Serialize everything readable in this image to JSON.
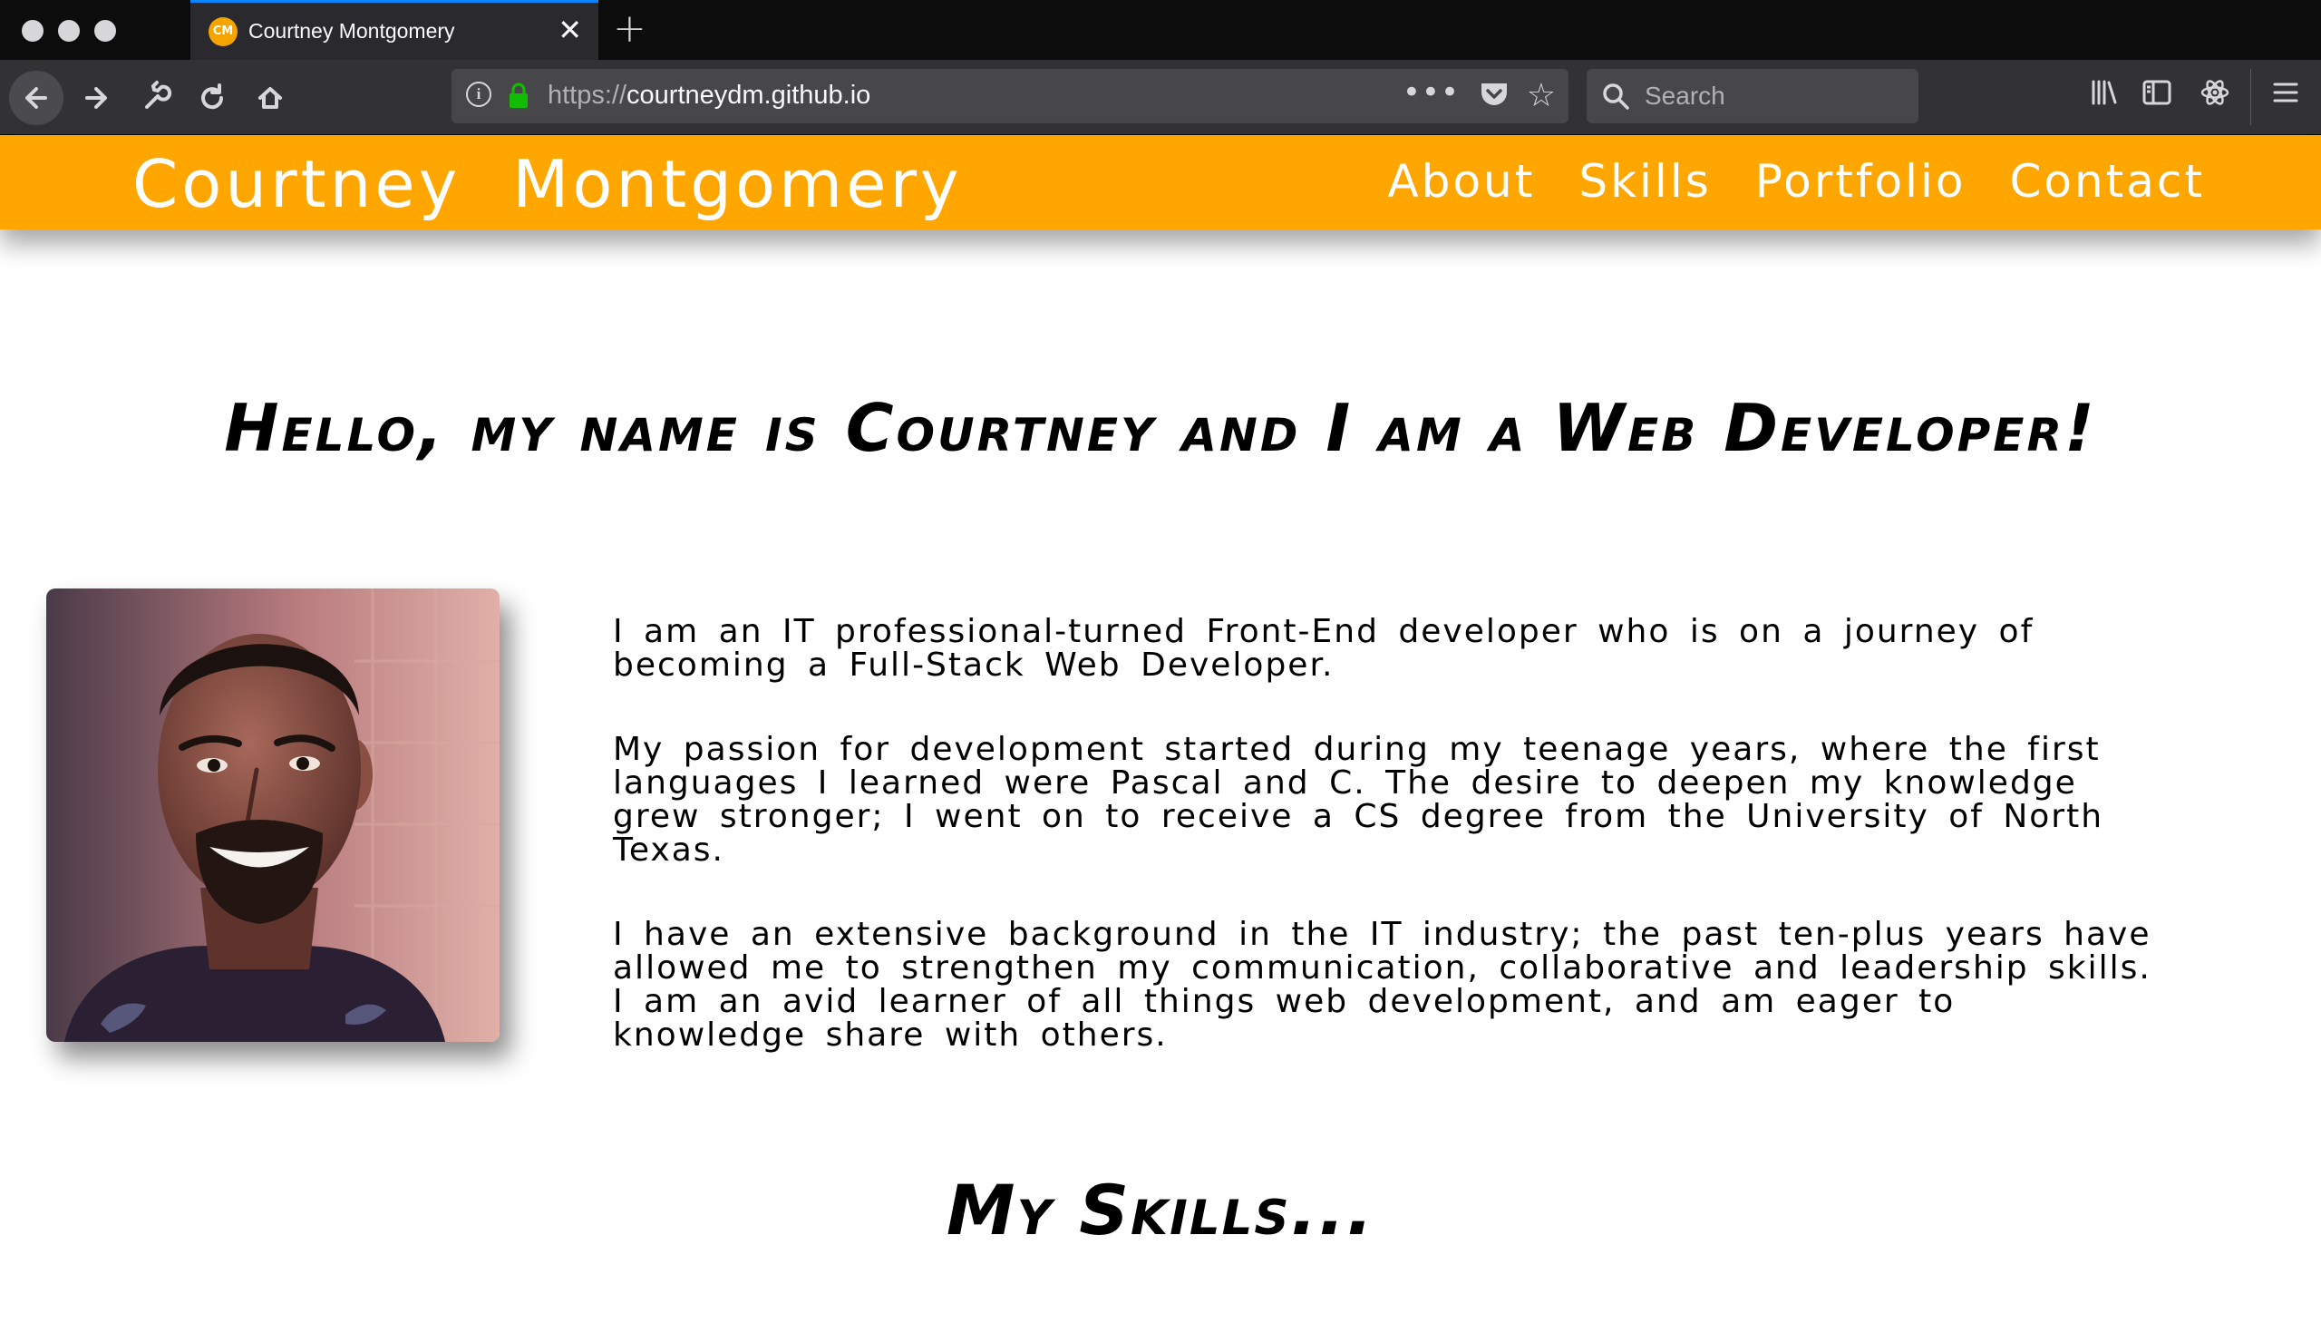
{
  "browser": {
    "tab": {
      "favicon_text": "CM",
      "title": "Courtney Montgomery"
    },
    "url": {
      "scheme": "https://",
      "host": "courtneydm.github.io"
    },
    "search": {
      "placeholder": "Search"
    }
  },
  "site": {
    "brand": "Courtney Montgomery",
    "nav": [
      "About",
      "Skills",
      "Portfolio",
      "Contact"
    ],
    "accent_color": "#ffa600"
  },
  "hero": {
    "title": "Hello, my name is Courtney and I am a Web Developer!"
  },
  "about": {
    "paragraphs": [
      "I am an IT professional-turned Front-End developer who is on a journey of becoming a Full-Stack Web Developer.",
      "My passion for development started during my teenage years, where the first languages I learned were Pascal and C. The desire to deepen my knowledge grew stronger; I went on to receive a CS degree from the University of North Texas.",
      "I have an extensive background in the IT industry; the past ten-plus years have allowed me to strengthen my communication, collaborative and leadership skills. I am an avid learner of all things web development, and am eager to knowledge share with others."
    ]
  },
  "skills": {
    "title": "My Skills..."
  }
}
